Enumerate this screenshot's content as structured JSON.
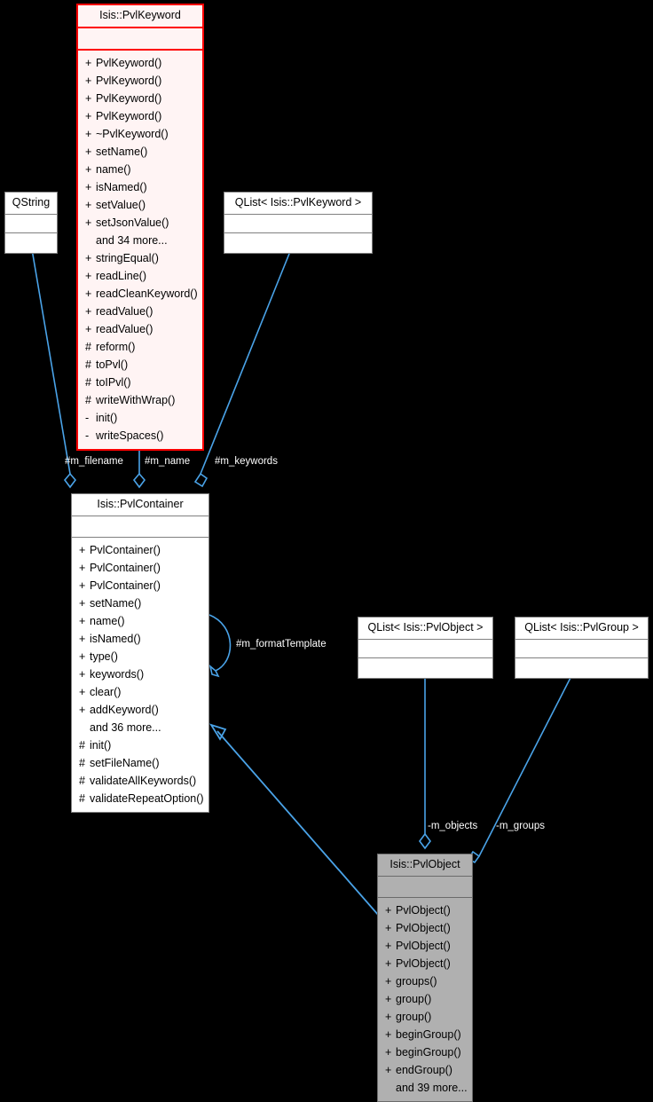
{
  "diagram": {
    "type": "uml-class-diagram",
    "background": "#000000",
    "edge_color": "#4aa3e8",
    "highlight_fill": "#fff4f4",
    "highlight_border": "#ff0000",
    "gray_fill": "#b0b0b0",
    "plain_fill": "#ffffff"
  },
  "nodes": {
    "pvlkeyword": {
      "title": "Isis::PvlKeyword",
      "methods": [
        {
          "vis": "+",
          "name": "PvlKeyword()"
        },
        {
          "vis": "+",
          "name": "PvlKeyword()"
        },
        {
          "vis": "+",
          "name": "PvlKeyword()"
        },
        {
          "vis": "+",
          "name": "PvlKeyword()"
        },
        {
          "vis": "+",
          "name": "~PvlKeyword()"
        },
        {
          "vis": "+",
          "name": "setName()"
        },
        {
          "vis": "+",
          "name": "name()"
        },
        {
          "vis": "+",
          "name": "isNamed()"
        },
        {
          "vis": "+",
          "name": "setValue()"
        },
        {
          "vis": "+",
          "name": "setJsonValue()"
        },
        {
          "vis": "",
          "name": "and 34 more..."
        },
        {
          "vis": "+",
          "name": "stringEqual()"
        },
        {
          "vis": "+",
          "name": "readLine()"
        },
        {
          "vis": "+",
          "name": "readCleanKeyword()"
        },
        {
          "vis": "+",
          "name": "readValue()"
        },
        {
          "vis": "+",
          "name": "readValue()"
        },
        {
          "vis": "#",
          "name": "reform()"
        },
        {
          "vis": "#",
          "name": "toPvl()"
        },
        {
          "vis": "#",
          "name": "toIPvl()"
        },
        {
          "vis": "#",
          "name": "writeWithWrap()"
        },
        {
          "vis": "-",
          "name": "init()"
        },
        {
          "vis": "-",
          "name": "writeSpaces()"
        }
      ]
    },
    "qstring": {
      "title": "QString",
      "methods": []
    },
    "qlist_pvlkeyword": {
      "title": "QList< Isis::PvlKeyword >",
      "methods": []
    },
    "pvlcontainer": {
      "title": "Isis::PvlContainer",
      "methods": [
        {
          "vis": "+",
          "name": "PvlContainer()"
        },
        {
          "vis": "+",
          "name": "PvlContainer()"
        },
        {
          "vis": "+",
          "name": "PvlContainer()"
        },
        {
          "vis": "+",
          "name": "setName()"
        },
        {
          "vis": "+",
          "name": "name()"
        },
        {
          "vis": "+",
          "name": "isNamed()"
        },
        {
          "vis": "+",
          "name": "type()"
        },
        {
          "vis": "+",
          "name": "keywords()"
        },
        {
          "vis": "+",
          "name": "clear()"
        },
        {
          "vis": "+",
          "name": "addKeyword()"
        },
        {
          "vis": "",
          "name": "and 36 more..."
        },
        {
          "vis": "#",
          "name": "init()"
        },
        {
          "vis": "#",
          "name": "setFileName()"
        },
        {
          "vis": "#",
          "name": "validateAllKeywords()"
        },
        {
          "vis": "#",
          "name": "validateRepeatOption()"
        }
      ]
    },
    "qlist_pvlobject": {
      "title": "QList< Isis::PvlObject >",
      "methods": []
    },
    "qlist_pvlgroup": {
      "title": "QList< Isis::PvlGroup >",
      "methods": []
    },
    "pvlobject": {
      "title": "Isis::PvlObject",
      "methods": [
        {
          "vis": "+",
          "name": "PvlObject()"
        },
        {
          "vis": "+",
          "name": "PvlObject()"
        },
        {
          "vis": "+",
          "name": "PvlObject()"
        },
        {
          "vis": "+",
          "name": "PvlObject()"
        },
        {
          "vis": "+",
          "name": "groups()"
        },
        {
          "vis": "+",
          "name": "group()"
        },
        {
          "vis": "+",
          "name": "group()"
        },
        {
          "vis": "+",
          "name": "beginGroup()"
        },
        {
          "vis": "+",
          "name": "beginGroup()"
        },
        {
          "vis": "+",
          "name": "endGroup()"
        },
        {
          "vis": "",
          "name": "and 39 more..."
        }
      ]
    }
  },
  "edge_labels": {
    "m_filename": "#m_filename",
    "m_name": "#m_name",
    "m_keywords": "#m_keywords",
    "m_formatTemplate": "#m_formatTemplate",
    "m_objects": "-m_objects",
    "m_groups": "-m_groups"
  }
}
